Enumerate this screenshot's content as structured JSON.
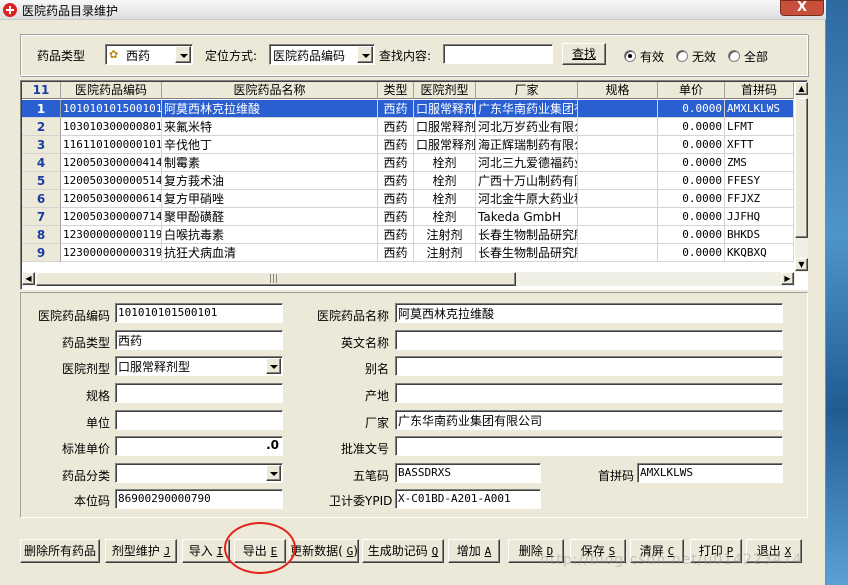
{
  "window": {
    "title": "医院药品目录维护",
    "close_label": "X"
  },
  "filter": {
    "type_label": "药品类型",
    "type_value": "西药",
    "locate_label": "定位方式:",
    "locate_value": "医院药品编码",
    "search_label": "查找内容:",
    "search_value": "",
    "search_button": "查找",
    "radio_valid": "有效",
    "radio_invalid": "无效",
    "radio_all": "全部",
    "selected_radio": "有效"
  },
  "grid": {
    "row_count": "11",
    "columns": [
      "医院药品编码",
      "医院药品名称",
      "类型",
      "医院剂型",
      "厂家",
      "规格",
      "单价",
      "首拼码"
    ],
    "rows": [
      {
        "n": "1",
        "code": "101010101500101",
        "name": "阿莫西林克拉维酸",
        "type": "西药",
        "form": "口服常释剂型",
        "maker": "广东华南药业集团有",
        "spec": "",
        "price": "0.0000",
        "py": "AMXLKLWS"
      },
      {
        "n": "2",
        "code": "103010300000801",
        "name": "来氟米特",
        "type": "西药",
        "form": "口服常释剂型",
        "maker": "河北万岁药业有限公",
        "spec": "",
        "price": "0.0000",
        "py": "LFMT"
      },
      {
        "n": "3",
        "code": "116110100000101",
        "name": "辛伐他丁",
        "type": "西药",
        "form": "口服常释剂型",
        "maker": "海正辉瑞制药有限公",
        "spec": "",
        "price": "0.0000",
        "py": "XFTT"
      },
      {
        "n": "4",
        "code": "120050300000414",
        "name": "制霉素",
        "type": "西药",
        "form": "栓剂",
        "maker": "河北三九爱德福药业",
        "spec": "",
        "price": "0.0000",
        "py": "ZMS"
      },
      {
        "n": "5",
        "code": "120050300000514",
        "name": "复方莪术油",
        "type": "西药",
        "form": "栓剂",
        "maker": "广西十万山制药有限",
        "spec": "",
        "price": "0.0000",
        "py": "FFESY"
      },
      {
        "n": "6",
        "code": "120050300000614",
        "name": "复方甲硝唑",
        "type": "西药",
        "form": "栓剂",
        "maker": "河北金牛原大药业科",
        "spec": "",
        "price": "0.0000",
        "py": "FFJXZ"
      },
      {
        "n": "7",
        "code": "120050300000714",
        "name": "聚甲酚磺醛",
        "type": "西药",
        "form": "栓剂",
        "maker": "Takeda GmbH",
        "spec": "",
        "price": "0.0000",
        "py": "JJFHQ"
      },
      {
        "n": "8",
        "code": "123000000000119",
        "name": "白喉抗毒素",
        "type": "西药",
        "form": "注射剂",
        "maker": "长春生物制品研究所",
        "spec": "",
        "price": "0.0000",
        "py": "BHKDS"
      },
      {
        "n": "9",
        "code": "123000000000319",
        "name": "抗狂犬病血清",
        "type": "西药",
        "form": "注射剂",
        "maker": "长春生物制品研究所",
        "spec": "",
        "price": "0.0000",
        "py": "KKQBXQ"
      }
    ]
  },
  "detail": {
    "code_label": "医院药品编码",
    "code_value": "101010101500101",
    "name_label": "医院药品名称",
    "name_value": "阿莫西林克拉维酸",
    "type_label": "药品类型",
    "type_value": "西药",
    "en_label": "英文名称",
    "en_value": "",
    "form_label": "医院剂型",
    "form_value": "口服常释剂型",
    "alias_label": "别名",
    "alias_value": "",
    "spec_label": "规格",
    "spec_value": "",
    "origin_label": "产地",
    "origin_value": "",
    "unit_label": "单位",
    "unit_value": "",
    "maker_label": "厂家",
    "maker_value": "广东华南药业集团有限公司",
    "price_label": "标准单价",
    "price_value": ".0",
    "approval_label": "批准文号",
    "approval_value": "",
    "category_label": "药品分类",
    "category_value": "",
    "wubi_label": "五笔码",
    "wubi_value": "BASSDRXS",
    "pinyin_label": "首拼码",
    "pinyin_value": "AMXLKLWS",
    "local_label": "本位码",
    "local_value": "86900290000790",
    "ypid_label": "卫计委YPID",
    "ypid_value": "X-C01BD-A201-A001"
  },
  "buttons": [
    {
      "text": "删除所有药品",
      "key": ""
    },
    {
      "text": "剂型维护",
      "key": "J"
    },
    {
      "text": "导入",
      "key": "I"
    },
    {
      "text": "导出",
      "key": "E"
    },
    {
      "text": "更新数据(",
      "key": "G",
      "tail": ")"
    },
    {
      "text": "生成助记码",
      "key": "Q"
    },
    {
      "text": "增加",
      "key": "A"
    },
    {
      "text": "删除",
      "key": "D"
    },
    {
      "text": "保存",
      "key": "S"
    },
    {
      "text": "清屏",
      "key": "C"
    },
    {
      "text": "打印",
      "key": "P"
    },
    {
      "text": "退出",
      "key": "X"
    }
  ],
  "watermark": "http://blog.csdn.net/u014223474"
}
